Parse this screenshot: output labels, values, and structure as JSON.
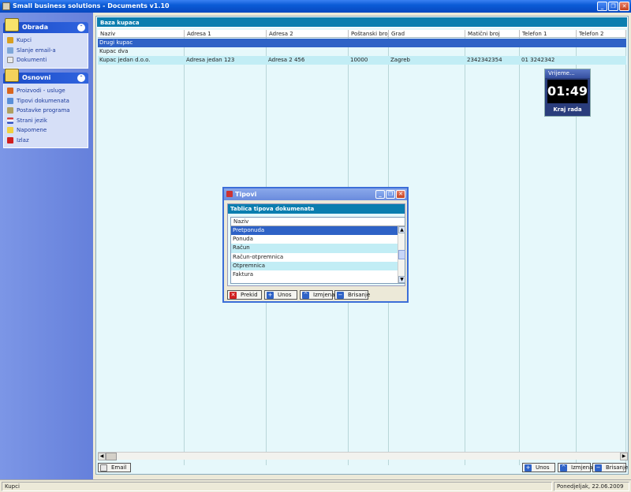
{
  "window": {
    "title": "Small business solutions - Documents v1.10"
  },
  "sidebar": {
    "groups": [
      {
        "title": "Obrada",
        "items": [
          {
            "label": "Kupci",
            "icon": "person-icon",
            "color": "#D9A020"
          },
          {
            "label": "Slanje email-a",
            "icon": "envelope-icon",
            "color": "#7FA7D8"
          },
          {
            "label": "Dokumenti",
            "icon": "document-icon",
            "color": "#E8E8E8"
          }
        ]
      },
      {
        "title": "Osnovni",
        "items": [
          {
            "label": "Proizvodi - usluge",
            "icon": "box-icon",
            "color": "#D9661E"
          },
          {
            "label": "Tipovi dokumenata",
            "icon": "magnifier-icon",
            "color": "#5A8FD8"
          },
          {
            "label": "Postavke programa",
            "icon": "settings-icon",
            "color": "#B0A060"
          },
          {
            "label": "Strani jezik",
            "icon": "flag-icon",
            "color": "#D04040"
          },
          {
            "label": "Napomene",
            "icon": "star-icon",
            "color": "#F0D040"
          },
          {
            "label": "Izlaz",
            "icon": "exit-icon",
            "color": "#D02020"
          }
        ]
      }
    ]
  },
  "main": {
    "header": "Baza kupaca",
    "columns": [
      "Naziv",
      "Adresa 1",
      "Adresa 2",
      "Poštanski broj",
      "Grad",
      "Matični broj",
      "Telefon 1",
      "Telefon 2"
    ],
    "rows": [
      [
        "Drugi kupac",
        "",
        "",
        "",
        "",
        "",
        "",
        ""
      ],
      [
        "Kupac dva",
        "",
        "",
        "",
        "",
        "",
        "",
        ""
      ],
      [
        "Kupac jedan d.o.o.",
        "Adresa jedan 123",
        "Adresa 2 456",
        "10000",
        "Zagreb",
        "2342342354",
        "01 3242342",
        ""
      ]
    ],
    "email_button": "Email",
    "unos_button": "Unos",
    "izmjena_button": "Izmjena",
    "brisanje_button": "Brisanje"
  },
  "clock": {
    "title": "Vrijeme...",
    "time": "01:49",
    "end_label": "Kraj rada"
  },
  "dialog": {
    "title": "Tipovi",
    "header": "Tablica tipova dokumenata",
    "column": "Naziv",
    "items": [
      "Pretponuda",
      "Ponuda",
      "Račun",
      "Račun-otpremnica",
      "Otpremnica",
      "Faktura"
    ],
    "buttons": {
      "prekid": "Prekid",
      "unos": "Unos",
      "izmjena": "Izmjena",
      "brisanje": "Brisanje"
    }
  },
  "status": {
    "left": "Kupci",
    "right": "Ponedjeljak, 22.06.2009"
  },
  "colors": {
    "header_blue": "#0B7EAF",
    "selection": "#2E62C6",
    "alt_row": "#C2EDF5"
  }
}
